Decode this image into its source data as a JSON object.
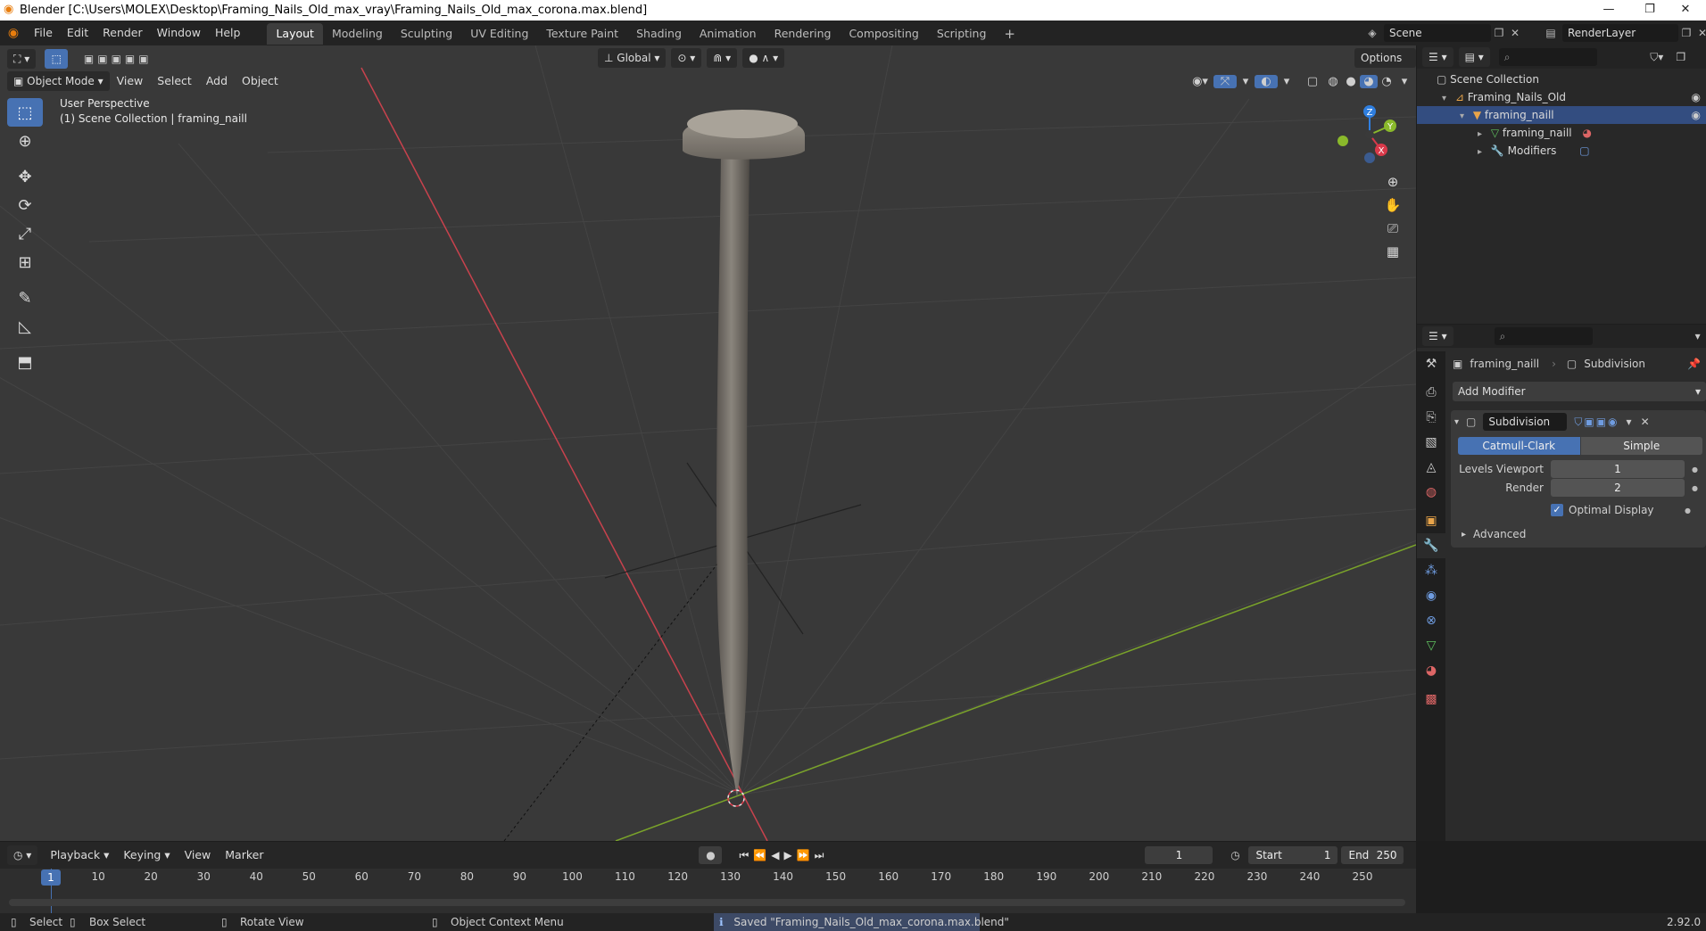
{
  "window": {
    "title": "Blender [C:\\Users\\MOLEX\\Desktop\\Framing_Nails_Old_max_vray\\Framing_Nails_Old_max_corona.max.blend]",
    "minimize": "—",
    "maximize": "❐",
    "close": "✕"
  },
  "menu": [
    "File",
    "Edit",
    "Render",
    "Window",
    "Help"
  ],
  "workspaces": [
    "Layout",
    "Modeling",
    "Sculpting",
    "UV Editing",
    "Texture Paint",
    "Shading",
    "Animation",
    "Rendering",
    "Compositing",
    "Scripting"
  ],
  "active_workspace": "Layout",
  "scene": {
    "name": "Scene",
    "render_layer": "RenderLayer"
  },
  "viewport": {
    "mode": "Object Mode",
    "menus": [
      "View",
      "Select",
      "Add",
      "Object"
    ],
    "transform_orientation": "Global",
    "options_label": "Options",
    "info_line1": "User Perspective",
    "info_line2": "(1) Scene Collection | framing_naill",
    "gizmo": {
      "x": "X",
      "y": "Y",
      "z": "Z"
    }
  },
  "outliner": {
    "root": "Scene Collection",
    "items": [
      {
        "label": "Framing_Nails_Old",
        "depth": 1
      },
      {
        "label": "framing_naill",
        "depth": 2
      },
      {
        "label": "framing_naill",
        "depth": 3
      },
      {
        "label": "Modifiers",
        "depth": 3
      }
    ]
  },
  "properties": {
    "breadcrumb_object": "framing_naill",
    "breadcrumb_modifier": "Subdivision",
    "add_modifier": "Add Modifier",
    "modifier_name": "Subdivision",
    "mode_catmull": "Catmull-Clark",
    "mode_simple": "Simple",
    "levels_viewport_label": "Levels Viewport",
    "levels_viewport_value": "1",
    "render_label": "Render",
    "render_value": "2",
    "optimal_display_label": "Optimal Display",
    "optimal_display_checked": true,
    "advanced_label": "Advanced"
  },
  "timeline": {
    "menus": [
      "Playback",
      "Keying",
      "View",
      "Marker"
    ],
    "current_frame": "1",
    "start_label": "Start",
    "start_value": "1",
    "end_label": "End",
    "end_value": "250",
    "frame_ticks": [
      "1",
      "10",
      "20",
      "30",
      "40",
      "50",
      "60",
      "70",
      "80",
      "90",
      "100",
      "110",
      "120",
      "130",
      "140",
      "150",
      "160",
      "170",
      "180",
      "190",
      "200",
      "210",
      "220",
      "230",
      "240",
      "250"
    ]
  },
  "status": {
    "select": "Select",
    "box_select": "Box Select",
    "rotate_view": "Rotate View",
    "context_menu": "Object Context Menu",
    "message": "Saved \"Framing_Nails_Old_max_corona.max.blend\"",
    "version": "2.92.0"
  },
  "colors": {
    "accent": "#4772b3",
    "x_axis": "#d9394a",
    "y_axis": "#8ab92b",
    "z_axis": "#2f7fe0"
  }
}
